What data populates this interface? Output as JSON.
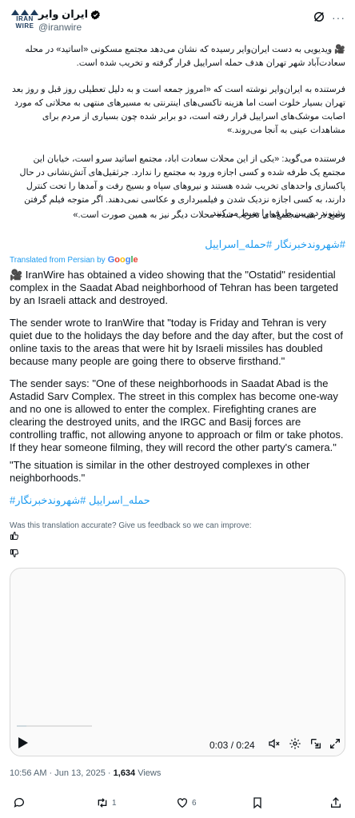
{
  "account": {
    "logo_text_1": "IRAN",
    "logo_text_2": "WIRE",
    "display_name": "ایران وایر",
    "handle": "@iranwire"
  },
  "original": {
    "p1": "🎥 ویدیویی به دست ایران‌وایر رسیده که نشان می‌دهد مجتمع مسکونی «اساتید» در محله سعادت‌آباد شهر تهران هدف حمله اسراییل قرار گرفته و تخریب شده است.",
    "p2": "فرستنده به ایران‌وایر نوشته است که «امروز جمعه است و به دلیل تعطیلی روز قبل و روز بعد تهران بسیار خلوت است اما هزینه تاکسی‌های اینترنتی به مسیر‌های منتهی به محلاتی که مورد اصابت موشک‌های اسراییل قرار رفته است، دو برابر شده چون بسیاری از مردم برای مشاهدات عینی به آنجا می‌روند.»",
    "p3": "فرستنده می‌گوید: «یکی از این محلات سعادت اباد، مجتمع اساتید سرو است، خیابان این مجتمع یک طرفه شده و کسی اجازه ورود به مجتمع را ندارد. جرثقیل‌های آتش‌نشانی در حال پاکسازی واحدهای تخریب شده هستند و نیروهای سپاه و بسیج رفت و آمدها را تحت کنترل دارند، به کسی اجازه نزدیک شدن و فیلمبرداری و عکاسی نمی‌دهند. اگر متوجه فیلم گرفتن بشنوند دوربین طرف را ضبط می‌کنند.",
    "p3b": "وضع در بقیه مجتمع‌های تخریب شده محلات دیگر نیز به همین صورت است.»",
    "hashtags": "#شهروندخبرنگار #حمله_اسراییل"
  },
  "translation": {
    "label": "Translated from Persian by",
    "provider": "Google",
    "p1": "🎥 IranWire has obtained a video showing that the \"Ostatid\" residential complex in the Saadat Abad neighborhood of Tehran has been targeted by an Israeli attack and destroyed.",
    "p2": "The sender wrote to IranWire that \"today is Friday and Tehran is very quiet due to the holidays the day before and the day after, but the cost of online taxis to the areas that were hit by Israeli missiles has doubled because many people are going there to observe firsthand.\"",
    "p3": "The sender says: \"One of these neighborhoods in Saadat Abad is the Astadid Sarv Complex. The street in this complex has become one-way and no one is allowed to enter the complex. Firefighting cranes are clearing the destroyed units, and the IRGC and Basij forces are controlling traffic, not allowing anyone to approach or film or take photos. If they hear someone filming, they will record the other party's camera.\"",
    "p4": "\"The situation is similar in the other destroyed complexes in other neighborhoods.\"",
    "hashtags": "#حمله_اسراییل #شهروندخبرنگار",
    "feedback": "Was this translation accurate? Give us feedback so we can improve:"
  },
  "video": {
    "time": "0:03 / 0:24",
    "progress": 0.125
  },
  "meta": {
    "timestamp": "10:56 AM · Jun 13, 2025 · ",
    "views_count": "1,634",
    "views_label": " Views"
  },
  "actions": {
    "retweets": "1",
    "likes": "6"
  },
  "colors": {
    "link": "#1d9bf0",
    "secondary_text": "#536471",
    "primary_text": "#0f1419",
    "logo": "#1d3b5c"
  }
}
